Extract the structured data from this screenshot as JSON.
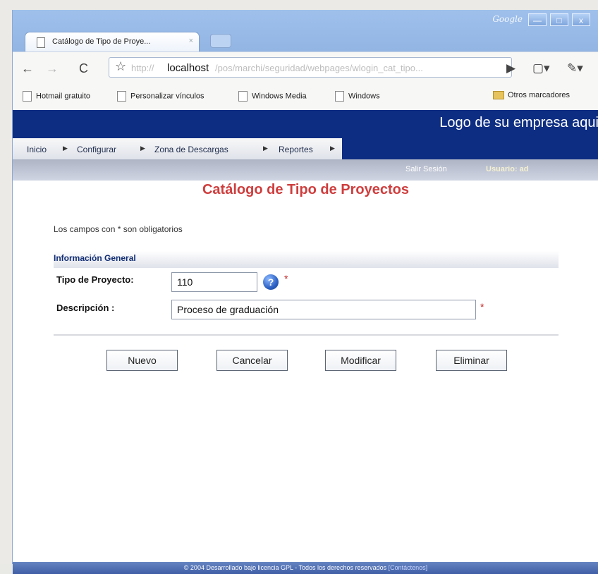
{
  "browser": {
    "tab_title": "Catálogo de Tipo de Proye...",
    "tab_close": "×",
    "google_label": "Google",
    "window_buttons": [
      "—",
      "□",
      "x"
    ],
    "address": {
      "prefix": "http://",
      "host": "localhost",
      "rest": "/pos/marchi/seguridad/webpages/wlogin_cat_tipo..."
    },
    "bookmarks": [
      "Hotmail gratuito",
      "Personalizar vínculos",
      "Windows Media",
      "Windows"
    ],
    "other_bookmarks": "Otros marcadores"
  },
  "app": {
    "brand_logo": "Logo de su empresa aqui",
    "menu": [
      "Inicio",
      "Configurar",
      "Zona de Descargas",
      "Reportes"
    ],
    "session": {
      "logout": "Salir Sesión",
      "user": "Usuario: ad"
    },
    "title": "Catálogo de Tipo de Proyectos",
    "notice": "Los campos con * son obligatorios",
    "section_title": "Información General",
    "fields": {
      "tipo_label": "Tipo de Proyecto:",
      "tipo_value": "110",
      "descripcion_label": "Descripción :",
      "descripcion_value": "Proceso de graduación",
      "required_mark": "*"
    },
    "buttons": {
      "nuevo": "Nuevo",
      "cancelar": "Cancelar",
      "modificar": "Modificar",
      "eliminar": "Eliminar"
    },
    "footer": {
      "text": "© 2004 Desarrollado bajo licencia GPL - Todos los derechos reservados",
      "link": "Contáctenos"
    }
  },
  "colors": {
    "brand_blue": "#0d2d82",
    "title_red": "#cf3d3d",
    "required_red": "#c21d1d"
  }
}
